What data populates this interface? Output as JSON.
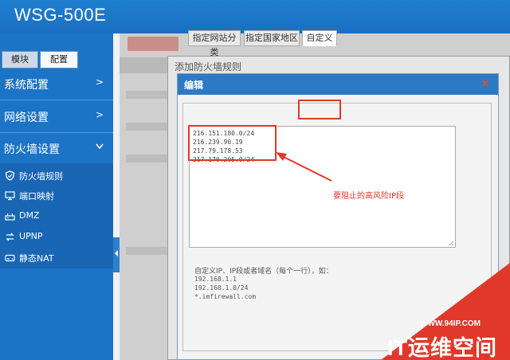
{
  "app": {
    "title": "WSG-500E"
  },
  "sidebar": {
    "tabs": [
      {
        "label": "模块"
      },
      {
        "label": "配置"
      }
    ],
    "menus": [
      {
        "label": "系统配置",
        "chevron": ">"
      },
      {
        "label": "网络设置",
        "chevron": ">"
      },
      {
        "label": "防火墙设置",
        "chevron": "v"
      }
    ],
    "sub_items": [
      {
        "label": "防火墙规则",
        "icon": "shield-icon"
      },
      {
        "label": "端口映射",
        "icon": "monitor-icon"
      },
      {
        "label": "DMZ",
        "icon": "router-icon"
      },
      {
        "label": "UPNP",
        "icon": "exchange-icon"
      },
      {
        "label": "静态NAT",
        "icon": "hdd-icon"
      }
    ]
  },
  "modal": {
    "title": "添加防火墙规则"
  },
  "dialog": {
    "title": "编辑",
    "close": "×",
    "tabs": [
      {
        "label": "指定网站分类"
      },
      {
        "label": "指定国家地区"
      },
      {
        "label": "自定义"
      }
    ],
    "ip_lines": [
      "216.151.180.0/24",
      "216.239.90.19",
      "217.79.178.53",
      "217.170.205.0/24"
    ],
    "hint": {
      "title": "自定义IP、IP段或者域名（每个一行），如：",
      "examples": [
        "192.168.1.1",
        "192.168.1.0/24",
        "*.imfirewall.com"
      ]
    }
  },
  "annotation": {
    "text": "要阻止的高风险IP段",
    "color": "#e0392b"
  },
  "watermark": {
    "url": "WWW.94IP.COM",
    "text": "IT运维空间",
    "color": "#e0392b"
  },
  "colors": {
    "header": "#1f7fd0",
    "sidebar": "#1c74c7",
    "dialog_title": "#2c79c4"
  }
}
